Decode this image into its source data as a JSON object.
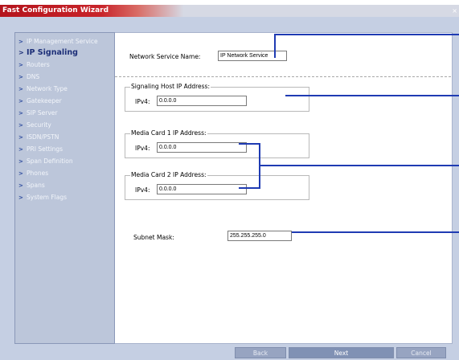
{
  "window": {
    "title": "Fast Configuration Wizard",
    "close_glyph": "×"
  },
  "sidebar": {
    "items": [
      {
        "label": "IP Management Service",
        "active": false
      },
      {
        "label": "IP Signaling",
        "active": true
      },
      {
        "label": "Routers",
        "active": false
      },
      {
        "label": "DNS",
        "active": false
      },
      {
        "label": "Network Type",
        "active": false
      },
      {
        "label": "Gatekeeper",
        "active": false
      },
      {
        "label": "SIP Server",
        "active": false
      },
      {
        "label": "Security",
        "active": false
      },
      {
        "label": "ISDN/PSTN",
        "active": false
      },
      {
        "label": "PRI Settings",
        "active": false
      },
      {
        "label": "Span Definition",
        "active": false
      },
      {
        "label": "Phones",
        "active": false
      },
      {
        "label": "Spans",
        "active": false
      },
      {
        "label": "System Flags",
        "active": false
      }
    ],
    "chevron_glyph": ">"
  },
  "form": {
    "network_service_name": {
      "label": "Network Service Name:",
      "value": "IP Network Service"
    },
    "signaling_host": {
      "legend": "Signaling Host IP Address:",
      "ipv4_label": "IPv4:",
      "value": "0.0.0.0"
    },
    "media_card_1": {
      "legend": "Media Card 1 IP Address:",
      "ipv4_label": "IPv4:",
      "value": "0.0.0.0"
    },
    "media_card_2": {
      "legend": "Media Card 2 IP Address:",
      "ipv4_label": "IPv4:",
      "value": "0.0.0.0"
    },
    "subnet_mask": {
      "label": "Subnet Mask:",
      "value": "255.255.255.0"
    }
  },
  "buttons": {
    "back": "Back",
    "next": "Next",
    "cancel": "Cancel"
  },
  "colors": {
    "title_red": "#c8242a",
    "panel_blue": "#c5cfe3",
    "active_nav": "#1d2f78",
    "callout": "#1f3bb3"
  }
}
